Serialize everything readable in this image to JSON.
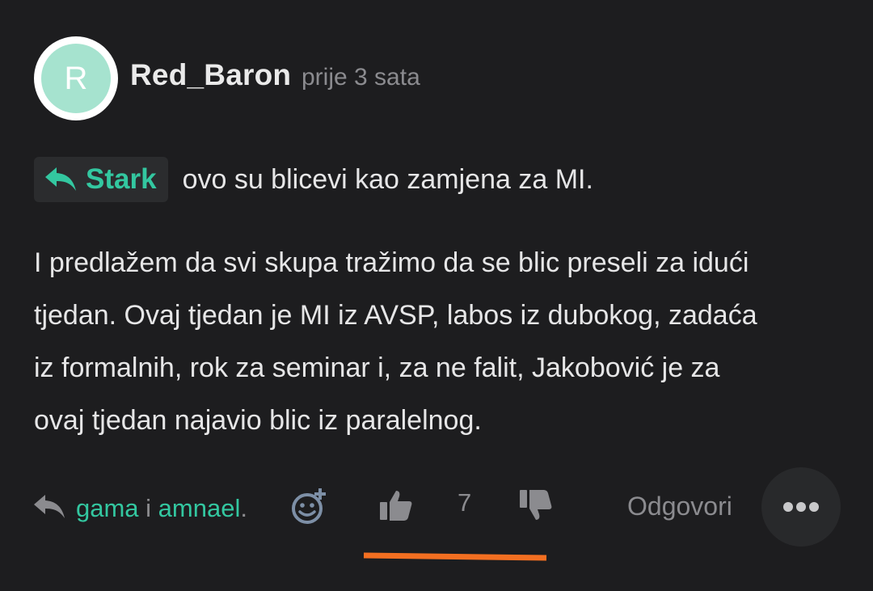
{
  "comment": {
    "avatar_letter": "R",
    "author": "Red_Baron",
    "time_ago": "prije 3 sata",
    "reply_to": "Stark",
    "reply_text": "ovo su blicevi kao zamjena za MI.",
    "body_lines": [
      "I predlažem da svi skupa tražimo da se blic preseli za idući",
      "tjedan. Ovaj tjedan je MI iz AVSP, labos iz dubokog, zadaća",
      "iz formalnih, rok za seminar i, za ne falit, Jakobović je za",
      "ovaj tjedan najavio blic iz paralelnog."
    ]
  },
  "actions": {
    "reactor_1": "gama",
    "reactor_sep": " i ",
    "reactor_2": "amnael",
    "reactor_end": ".",
    "score": "7",
    "reply_label": "Odgovori"
  },
  "icons": {
    "reply_arrow": "reply-arrow-icon",
    "emoji_add": "emoji-add-icon",
    "like": "thumbs-up-icon",
    "dislike": "thumbs-down-icon",
    "more": "more-dots-icon"
  },
  "colors": {
    "background": "#1d1d1f",
    "accent": "#33c7a0",
    "avatar_fill": "#a6e3cf",
    "muted": "#8b8b8f",
    "highlight": "#f36f21"
  }
}
